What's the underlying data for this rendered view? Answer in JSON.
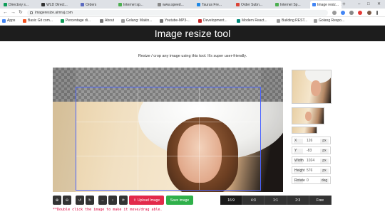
{
  "browser": {
    "tabs": [
      {
        "label": "Directory s...",
        "color": "#0f9d58"
      },
      {
        "label": "WLD Direct...",
        "color": "#333333"
      },
      {
        "label": "Orders",
        "color": "#5c6bc0"
      },
      {
        "label": "Internet sp...",
        "color": "#4caf50"
      },
      {
        "label": "www.speed...",
        "color": "#888888"
      },
      {
        "label": "Taurus Fre...",
        "color": "#1e88e5"
      },
      {
        "label": "Order Subn...",
        "color": "#db4437"
      },
      {
        "label": "Internet Sp...",
        "color": "#4caf50"
      },
      {
        "label": "Image resiz...",
        "color": "#4285f4"
      }
    ],
    "url": "imageresize.aimraj.com",
    "bookmarks": [
      {
        "label": "Apps",
        "color": "#4285f4"
      },
      {
        "label": "Basic Git com...",
        "color": "#f4511e"
      },
      {
        "label": "Percentage di...",
        "color": "#0f9d58"
      },
      {
        "label": "About",
        "color": "#777777"
      },
      {
        "label": "Golang: Makin...",
        "color": "#9e9e9e"
      },
      {
        "label": "Youtube-MP3-...",
        "color": "#757575"
      },
      {
        "label": "Development...",
        "color": "#c62828"
      },
      {
        "label": "Modern React...",
        "color": "#00897b"
      },
      {
        "label": "Building REST...",
        "color": "#9e9e9e"
      },
      {
        "label": "Golang Respo...",
        "color": "#9e9e9e"
      }
    ]
  },
  "page": {
    "title": "Image resize tool",
    "subtitle": "Resize / crop any image using this tool. It's super user-friendly."
  },
  "crop_info": {
    "x": {
      "label": "X",
      "value": "126",
      "unit": "px"
    },
    "y": {
      "label": "Y",
      "value": "-83",
      "unit": "px"
    },
    "width": {
      "label": "Width",
      "value": "1024",
      "unit": "px"
    },
    "height": {
      "label": "Height",
      "value": "576",
      "unit": "px"
    },
    "rotate": {
      "label": "Rotate",
      "value": "0",
      "unit": "deg"
    }
  },
  "toolbar": {
    "upload_label": "Upload Image",
    "save_label": "Save image"
  },
  "aspect_ratios": [
    "16:9",
    "4:3",
    "1:1",
    "2:3",
    "Free"
  ],
  "active_ratio": "16:9",
  "hint": "**Double click the image to make it move/drag able."
}
